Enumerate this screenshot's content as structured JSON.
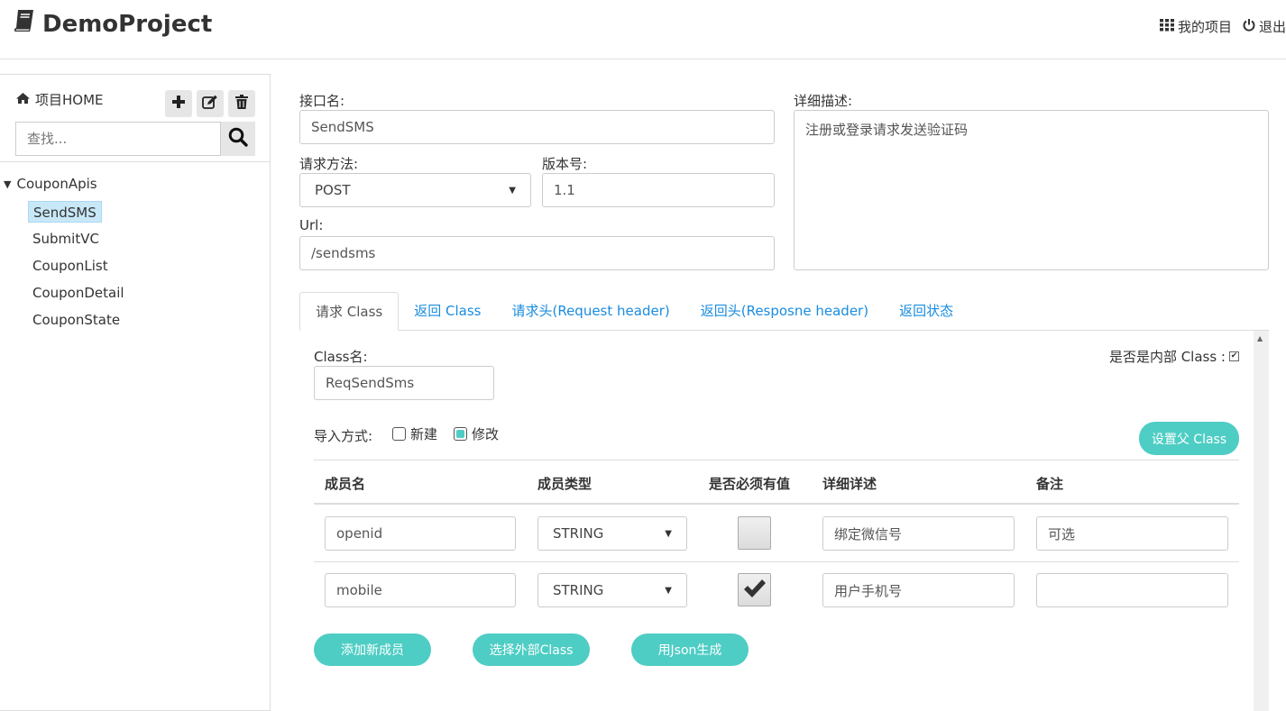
{
  "header": {
    "title": "DemoProject",
    "my_projects": "我的项目",
    "logout": "退出"
  },
  "sidebar": {
    "home_label": "项目HOME",
    "search_placeholder": "查找...",
    "root": "CouponApis",
    "items": [
      "SendSMS",
      "SubmitVC",
      "CouponList",
      "CouponDetail",
      "CouponState"
    ],
    "active_index": 0
  },
  "form": {
    "name_label": "接口名:",
    "name_value": "SendSMS",
    "method_label": "请求方法:",
    "method_value": "POST",
    "version_label": "版本号:",
    "version_value": "1.1",
    "url_label": "Url:",
    "url_value": "/sendsms",
    "desc_label": "详细描述:",
    "desc_value": "注册或登录请求发送验证码"
  },
  "tabs": [
    "请求 Class",
    "返回 Class",
    "请求头(Request header)",
    "返回头(Resposne header)",
    "返回状态"
  ],
  "class_panel": {
    "class_name_label": "Class名:",
    "class_name_value": "ReqSendSms",
    "inner_label": "是否是内部 Class :",
    "import_label": "导入方式:",
    "opt_new": "新建",
    "opt_modify": "修改",
    "set_parent": "设置父 Class",
    "columns": [
      "成员名",
      "成员类型",
      "是否必须有值",
      "详细详述",
      "备注"
    ],
    "rows": [
      {
        "name": "openid",
        "type": "STRING",
        "required": false,
        "desc": "绑定微信号",
        "note": "可选"
      },
      {
        "name": "mobile",
        "type": "STRING",
        "required": true,
        "desc": "用户手机号",
        "note": ""
      }
    ],
    "btn_add": "添加新成员",
    "btn_external": "选择外部Class",
    "btn_json": "用Json生成"
  },
  "colors": {
    "accent": "#4ecdc4",
    "link": "#1a8cdf",
    "active_item": "#c8e8f8"
  }
}
